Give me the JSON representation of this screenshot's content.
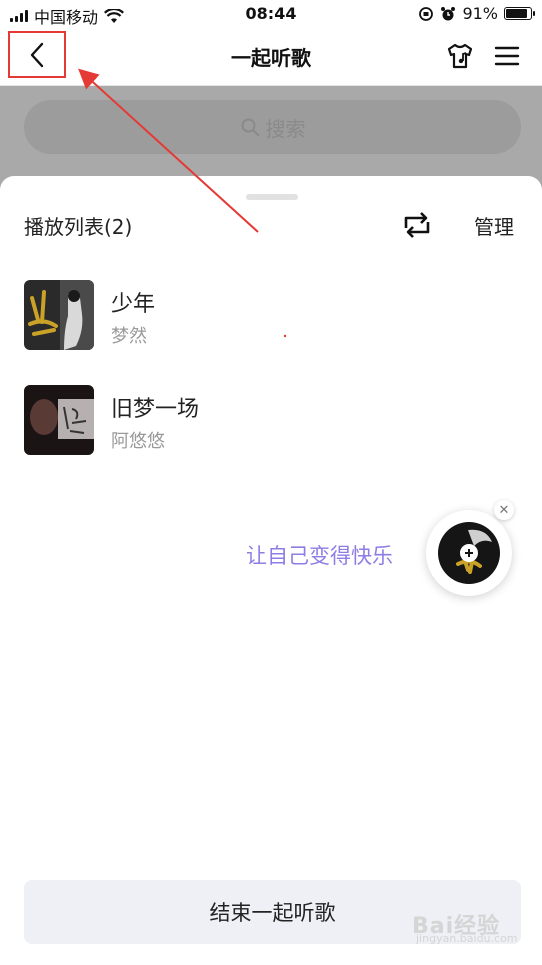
{
  "status_bar": {
    "carrier": "中国移动",
    "time": "08:44",
    "battery": "91%",
    "battery_level": 0.91
  },
  "nav": {
    "title": "一起听歌",
    "back_icon": "chevron-left-icon",
    "skin_icon": "tshirt-icon",
    "menu_icon": "menu-icon"
  },
  "search": {
    "placeholder": "搜索"
  },
  "playlist": {
    "title": "播放列表(2)",
    "manage_label": "管理",
    "songs": [
      {
        "title": "少年",
        "artist": "梦然"
      },
      {
        "title": "旧梦一场",
        "artist": "阿悠悠"
      }
    ]
  },
  "promo": {
    "slogan": "让自己变得快乐"
  },
  "footer": {
    "end_label": "结束一起听歌"
  },
  "watermark": {
    "text": "Bai经验",
    "url": "jingyan.baidu.com"
  },
  "colors": {
    "accent": "#8d7ee6",
    "annotation": "#e53935",
    "overlay": "#a9a9a9"
  }
}
